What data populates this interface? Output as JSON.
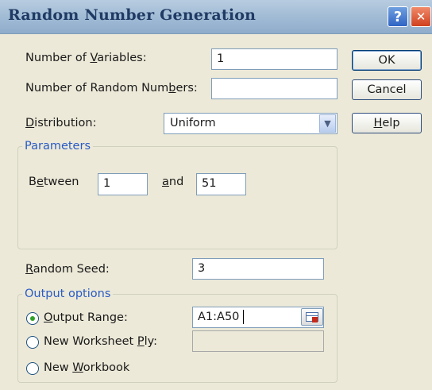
{
  "window": {
    "title": "Random Number Generation"
  },
  "fields": {
    "num_variables": {
      "label_pre": "Number of ",
      "label_u": "V",
      "label_post": "ariables:",
      "value": "1"
    },
    "num_random": {
      "label_pre": "Number of Random Num",
      "label_u": "b",
      "label_post": "ers:",
      "value": ""
    },
    "distribution": {
      "label_pre": "",
      "label_u": "D",
      "label_post": "istribution:",
      "value": "Uniform"
    }
  },
  "buttons": {
    "ok": "OK",
    "cancel": "Cancel",
    "help_u": "H",
    "help_post": "elp"
  },
  "parameters": {
    "title": "Parameters",
    "between_pre": "B",
    "between_u": "e",
    "between_post": "tween",
    "between_value": "1",
    "and_u": "a",
    "and_post": "nd",
    "and_value": "51"
  },
  "seed": {
    "label_u": "R",
    "label_post": "andom Seed:",
    "value": "3"
  },
  "output": {
    "title": "Output options",
    "range_u": "O",
    "range_post": "utput Range:",
    "range_value": "A1:A50",
    "ply_pre": "New Worksheet ",
    "ply_u": "P",
    "ply_post": "ly:",
    "ply_value": "",
    "wb_pre": "New ",
    "wb_u": "W",
    "wb_post": "orkbook",
    "selected": "output_range"
  },
  "icons": {
    "help": "?",
    "close": "✕",
    "dropdown": "▼"
  }
}
